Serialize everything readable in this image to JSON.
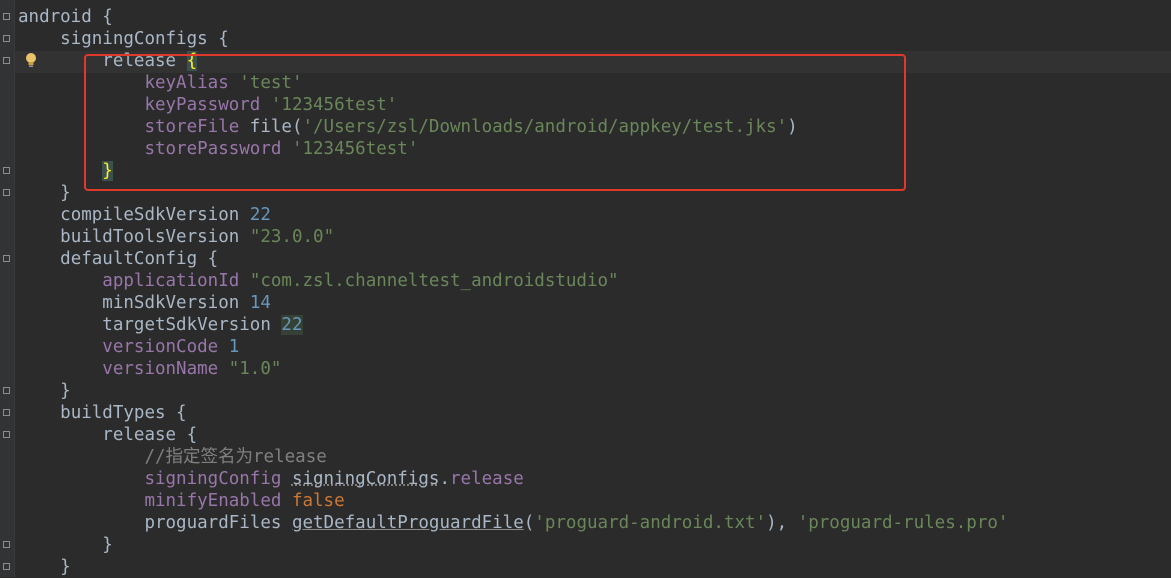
{
  "editor": {
    "lines": [
      {
        "indent": "",
        "tokens": [
          {
            "t": "android {",
            "c": "plain"
          }
        ]
      },
      {
        "indent": "    ",
        "tokens": [
          {
            "t": "signingConfigs {",
            "c": "plain"
          }
        ]
      },
      {
        "indent": "        ",
        "tokens": [
          {
            "t": "release ",
            "c": "plain"
          },
          {
            "t": "{",
            "c": "brace-hl"
          }
        ]
      },
      {
        "indent": "            ",
        "tokens": [
          {
            "t": "keyAlias ",
            "c": "prop"
          },
          {
            "t": "'test'",
            "c": "str"
          }
        ]
      },
      {
        "indent": "            ",
        "tokens": [
          {
            "t": "keyPassword ",
            "c": "prop"
          },
          {
            "t": "'123456test'",
            "c": "str"
          }
        ]
      },
      {
        "indent": "            ",
        "tokens": [
          {
            "t": "storeFile ",
            "c": "prop"
          },
          {
            "t": "file(",
            "c": "plain"
          },
          {
            "t": "'/Users/zsl/Downloads/android/appkey/test.jks'",
            "c": "str"
          },
          {
            "t": ")",
            "c": "plain"
          }
        ]
      },
      {
        "indent": "            ",
        "tokens": [
          {
            "t": "storePassword ",
            "c": "prop"
          },
          {
            "t": "'123456test'",
            "c": "str"
          }
        ]
      },
      {
        "indent": "        ",
        "tokens": [
          {
            "t": "}",
            "c": "brace-hl"
          }
        ]
      },
      {
        "indent": "    ",
        "tokens": [
          {
            "t": "}",
            "c": "plain"
          }
        ]
      },
      {
        "indent": "    ",
        "tokens": [
          {
            "t": "compileSdkVersion ",
            "c": "plain"
          },
          {
            "t": "22",
            "c": "num"
          }
        ]
      },
      {
        "indent": "    ",
        "tokens": [
          {
            "t": "buildToolsVersion ",
            "c": "plain"
          },
          {
            "t": "\"23.0.0\"",
            "c": "str"
          }
        ]
      },
      {
        "indent": "    ",
        "tokens": [
          {
            "t": "defaultConfig {",
            "c": "plain"
          }
        ]
      },
      {
        "indent": "        ",
        "tokens": [
          {
            "t": "applicationId ",
            "c": "prop"
          },
          {
            "t": "\"com.zsl.channeltest_androidstudio\"",
            "c": "str"
          }
        ]
      },
      {
        "indent": "        ",
        "tokens": [
          {
            "t": "minSdkVersion ",
            "c": "plain"
          },
          {
            "t": "14",
            "c": "num"
          }
        ]
      },
      {
        "indent": "        ",
        "tokens": [
          {
            "t": "targetSdkVersion ",
            "c": "plain"
          },
          {
            "t": "22",
            "c": "num num-hl"
          }
        ]
      },
      {
        "indent": "        ",
        "tokens": [
          {
            "t": "versionCode ",
            "c": "prop"
          },
          {
            "t": "1",
            "c": "num"
          }
        ]
      },
      {
        "indent": "        ",
        "tokens": [
          {
            "t": "versionName ",
            "c": "prop"
          },
          {
            "t": "\"1.0\"",
            "c": "str"
          }
        ]
      },
      {
        "indent": "    ",
        "tokens": [
          {
            "t": "}",
            "c": "plain"
          }
        ]
      },
      {
        "indent": "    ",
        "tokens": [
          {
            "t": "buildTypes {",
            "c": "plain"
          }
        ]
      },
      {
        "indent": "        ",
        "tokens": [
          {
            "t": "release {",
            "c": "plain"
          }
        ]
      },
      {
        "indent": "            ",
        "tokens": [
          {
            "t": "//指定签名为release",
            "c": "cmt"
          }
        ]
      },
      {
        "indent": "            ",
        "tokens": [
          {
            "t": "signingConfig ",
            "c": "prop"
          },
          {
            "t": "signingConfigs",
            "c": "prop-ul"
          },
          {
            "t": ".",
            "c": "plain"
          },
          {
            "t": "release",
            "c": "prop"
          }
        ]
      },
      {
        "indent": "            ",
        "tokens": [
          {
            "t": "minifyEnabled ",
            "c": "prop"
          },
          {
            "t": "false",
            "c": "kw"
          }
        ]
      },
      {
        "indent": "            ",
        "tokens": [
          {
            "t": "proguardFiles ",
            "c": "plain"
          },
          {
            "t": "getDefaultProguardFile",
            "c": "meth-ul"
          },
          {
            "t": "(",
            "c": "plain"
          },
          {
            "t": "'proguard-android.txt'",
            "c": "str"
          },
          {
            "t": "), ",
            "c": "plain"
          },
          {
            "t": "'proguard-rules.pro'",
            "c": "str"
          }
        ]
      },
      {
        "indent": "        ",
        "tokens": [
          {
            "t": "}",
            "c": "plain"
          }
        ]
      },
      {
        "indent": "    ",
        "tokens": [
          {
            "t": "}",
            "c": "plain"
          }
        ]
      }
    ],
    "fold_markers": [
      0,
      1,
      2,
      7,
      8,
      11,
      17,
      18,
      19,
      24,
      25
    ],
    "bulb_icon": "lightbulb-icon",
    "highlight_color": "#e0392b"
  }
}
